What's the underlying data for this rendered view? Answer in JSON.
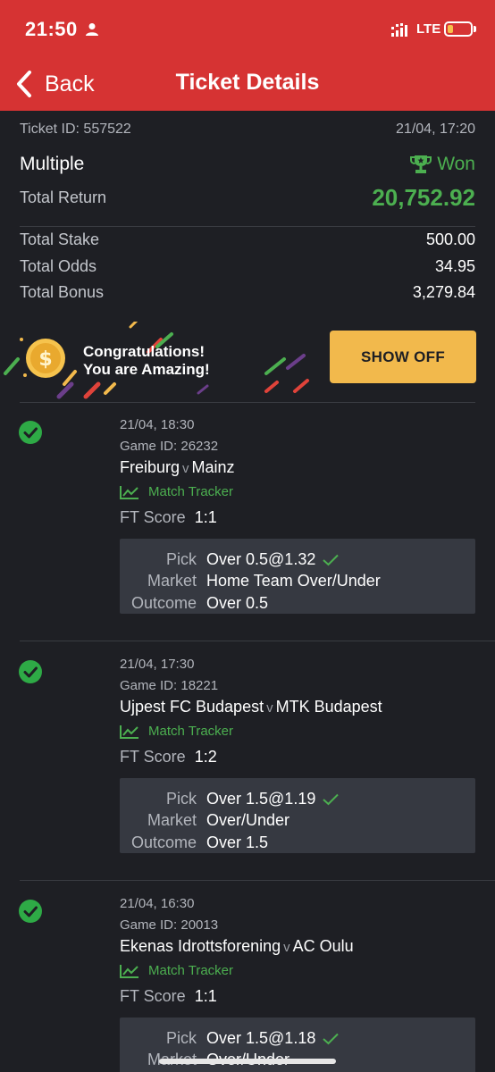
{
  "status_bar": {
    "time": "21:50",
    "network": "LTE"
  },
  "header": {
    "back_label": "Back",
    "title": "Ticket Details"
  },
  "summary": {
    "ticket_id": "Ticket ID: 557522",
    "created_at": "21/04, 17:20",
    "bet_type": "Multiple",
    "status": "Won",
    "total_return_label": "Total Return",
    "total_return_value": "20,752.92",
    "stats": [
      {
        "label": "Total Stake",
        "value": "500.00"
      },
      {
        "label": "Total Odds",
        "value": "34.95"
      },
      {
        "label": "Total Bonus",
        "value": "3,279.84"
      }
    ]
  },
  "banner": {
    "line1": "Congratulations!",
    "line2": "You are Amazing!",
    "button": "SHOW OFF"
  },
  "bets": [
    {
      "date": "21/04, 18:30",
      "game_id": "Game ID: 26232",
      "home": "Freiburg",
      "vs": "v",
      "away": "Mainz",
      "tracker": "Match Tracker",
      "ft_label": "FT Score",
      "ft_value": "1:1",
      "pick_label": "Pick",
      "pick": "Over 0.5@1.32",
      "market_label": "Market",
      "market": "Home Team Over/Under",
      "outcome_label": "Outcome",
      "outcome": "Over 0.5"
    },
    {
      "date": "21/04, 17:30",
      "game_id": "Game ID: 18221",
      "home": "Ujpest FC Budapest",
      "vs": "v",
      "away": "MTK Budapest",
      "tracker": "Match Tracker",
      "ft_label": "FT Score",
      "ft_value": "1:2",
      "pick_label": "Pick",
      "pick": "Over 1.5@1.19",
      "market_label": "Market",
      "market": "Over/Under",
      "outcome_label": "Outcome",
      "outcome": "Over 1.5"
    },
    {
      "date": "21/04, 16:30",
      "game_id": "Game ID: 20013",
      "home": "Ekenas Idrottsforening",
      "vs": "v",
      "away": "AC Oulu",
      "tracker": "Match Tracker",
      "ft_label": "FT Score",
      "ft_value": "1:1",
      "pick_label": "Pick",
      "pick": "Over 1.5@1.18",
      "market_label": "Market",
      "market": "Over/Under"
    }
  ],
  "colors": {
    "header_red": "#d63333",
    "background": "#1e1f24",
    "won_green": "#4caf50",
    "show_off_button": "#f2b94c",
    "pick_box": "#363941"
  },
  "icons": [
    "person-icon",
    "signal-icon",
    "battery-icon",
    "back-chevron-icon",
    "trophy-icon",
    "coin-icon",
    "check-circle-icon",
    "match-tracker-icon",
    "tick-icon"
  ]
}
